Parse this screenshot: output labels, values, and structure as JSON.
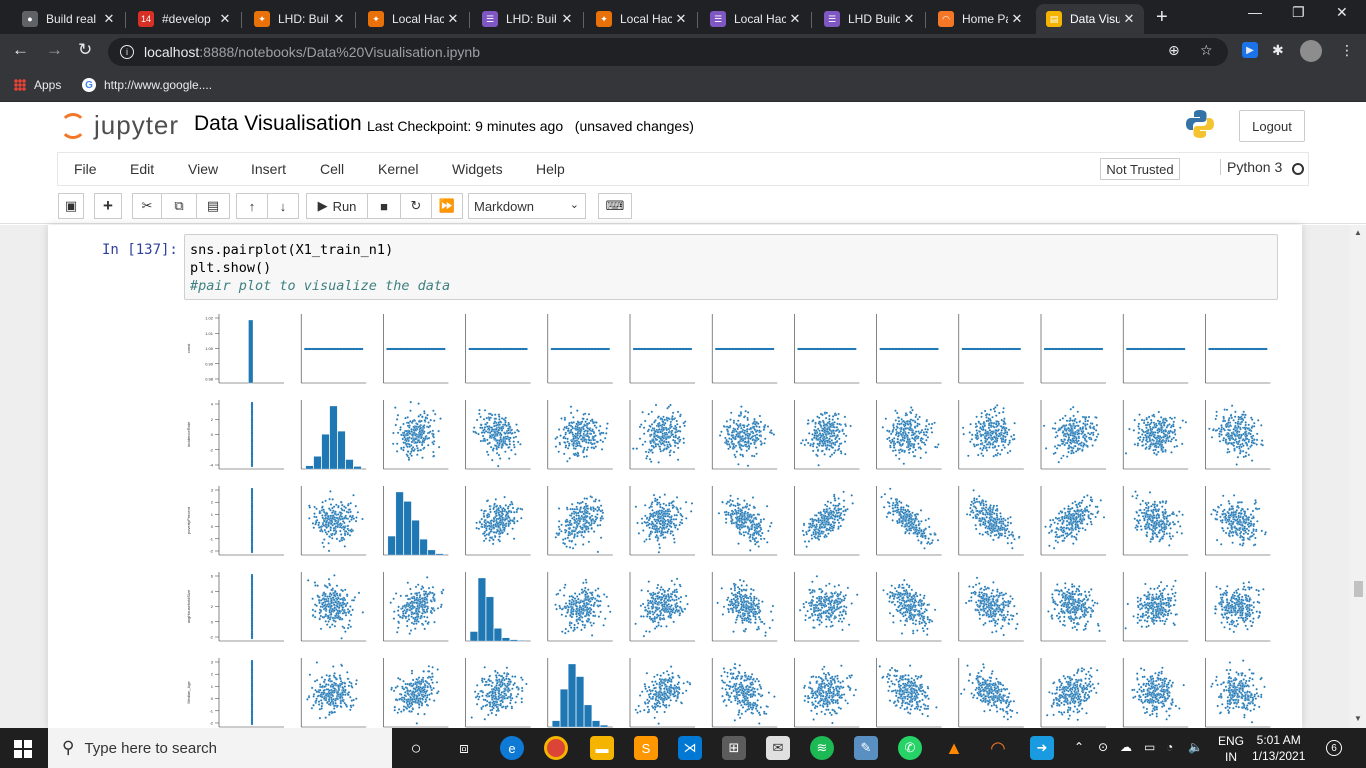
{
  "browser": {
    "tabs": [
      {
        "label": "Build real",
        "fav_color": "#5f6368",
        "fav_glyph": "●"
      },
      {
        "label": "#develop",
        "fav_color": "#d93025",
        "fav_glyph": "14"
      },
      {
        "label": "LHD: Buil",
        "fav_color": "#e8710a",
        "fav_glyph": "✦"
      },
      {
        "label": "Local Hac",
        "fav_color": "#e8710a",
        "fav_glyph": "✦"
      },
      {
        "label": "LHD: Buil",
        "fav_color": "#7e57c2",
        "fav_glyph": "☰"
      },
      {
        "label": "Local Hac",
        "fav_color": "#e8710a",
        "fav_glyph": "✦"
      },
      {
        "label": "Local Hac",
        "fav_color": "#7e57c2",
        "fav_glyph": "☰"
      },
      {
        "label": "LHD Builc",
        "fav_color": "#7e57c2",
        "fav_glyph": "☰"
      },
      {
        "label": "Home Pa",
        "fav_color": "#f37726",
        "fav_glyph": "◠"
      },
      {
        "label": "Data Visu",
        "fav_color": "#f4b400",
        "fav_glyph": "▤"
      }
    ],
    "url_host": "localhost",
    "url_path": ":8888/notebooks/Data%20Visualisation.ipynb",
    "bookmarks": {
      "apps": "Apps",
      "google": "http://www.google...."
    }
  },
  "jupyter": {
    "logo_text": "jupyter",
    "title": "Data Visualisation",
    "checkpoint": "Last Checkpoint: 9 minutes ago",
    "unsaved": "(unsaved changes)",
    "logout": "Logout",
    "menu": [
      "File",
      "Edit",
      "View",
      "Insert",
      "Cell",
      "Kernel",
      "Widgets",
      "Help"
    ],
    "trusted": "Not Trusted",
    "kernel": "Python 3",
    "run_label": "Run",
    "cell_type": "Markdown"
  },
  "cell": {
    "prompt": "In [137]:",
    "code_line1": "sns.pairplot(X1_train_n1)",
    "code_line2": "plt.show()",
    "code_comment": "#pair plot to visualize the data"
  },
  "chart_data": {
    "type": "scatter",
    "description_kind": "seaborn pairplot grid (13 columns, first 5 rows visible)",
    "point_color": "#1f77b4",
    "row_labels": [
      "const",
      "incidenceRate",
      "povertyPercent",
      "avgHouseholdSize",
      "Median_Age"
    ],
    "first_row_ticks": [
      "1.02",
      "1.01",
      "1.00",
      "0.99",
      "0.98"
    ],
    "row_ticks": [
      [
        "1.02",
        "1.01",
        "1.00",
        "0.99",
        "0.98"
      ],
      [
        "4",
        "2",
        "0",
        "-2",
        "-4"
      ],
      [
        "3",
        "2",
        "1",
        "0",
        "-1",
        "-2"
      ],
      [
        "6",
        "4",
        "2",
        "0",
        "-2"
      ],
      [
        "3",
        "2",
        "1",
        "0",
        "-1",
        "-2"
      ]
    ],
    "n_columns": 13,
    "diagonal_histogram_bars": [
      [
        0,
        0,
        0,
        1.0,
        0,
        0,
        0
      ],
      [
        0.05,
        0.2,
        0.55,
        1.0,
        0.6,
        0.15,
        0.04
      ],
      [
        0.3,
        1.0,
        0.85,
        0.55,
        0.25,
        0.08,
        0.02
      ],
      [
        0.15,
        1.0,
        0.7,
        0.2,
        0.05,
        0.02,
        0.01
      ],
      [
        0.1,
        0.6,
        1.0,
        0.8,
        0.35,
        0.1,
        0.03
      ]
    ],
    "correlations": [
      [
        0,
        0,
        0,
        0,
        0,
        0,
        0,
        0,
        0,
        0,
        0,
        0,
        0
      ],
      [
        0,
        0,
        0.1,
        -0.1,
        0.05,
        0.1,
        0.1,
        0.1,
        0,
        0.1,
        0.1,
        0,
        -0.1
      ],
      [
        0,
        0.1,
        0,
        0.3,
        0.3,
        0.2,
        -0.5,
        0.6,
        -0.8,
        -0.6,
        0.6,
        -0.3,
        -0.2
      ],
      [
        0,
        -0.1,
        0.3,
        0,
        0.1,
        0.1,
        -0.3,
        0.1,
        -0.4,
        -0.3,
        -0.3,
        0.2,
        0.1
      ],
      [
        0,
        0.05,
        0.3,
        0.1,
        0,
        0.3,
        -0.4,
        0.2,
        -0.5,
        -0.5,
        0.3,
        -0.1,
        -0.1
      ]
    ]
  },
  "taskbar": {
    "search_placeholder": "Type here to search",
    "lang1": "ENG",
    "lang2": "IN",
    "time": "5:01 AM",
    "date": "1/13/2021",
    "notif_count": "6"
  }
}
